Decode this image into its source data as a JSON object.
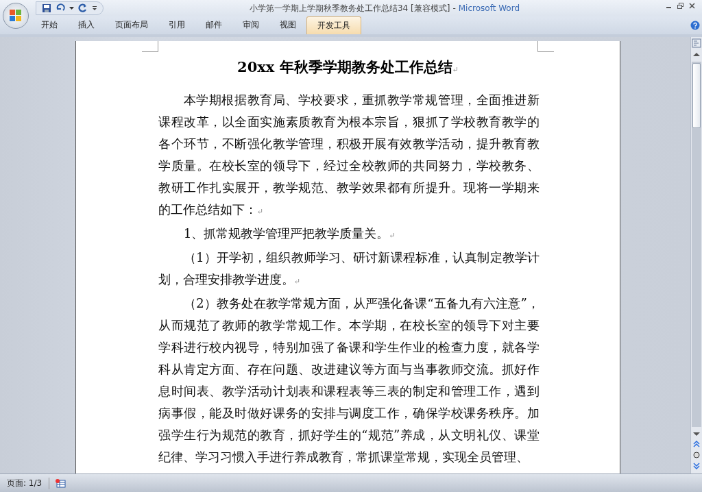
{
  "window": {
    "document_title": "小学第一学期上学期秋季教务处工作总结34 [兼容模式]",
    "separator": "-",
    "app_name": "Microsoft Word"
  },
  "tabs": [
    {
      "label": "开始",
      "selected": false
    },
    {
      "label": "插入",
      "selected": false
    },
    {
      "label": "页面布局",
      "selected": false
    },
    {
      "label": "引用",
      "selected": false
    },
    {
      "label": "邮件",
      "selected": false
    },
    {
      "label": "审阅",
      "selected": false
    },
    {
      "label": "视图",
      "selected": false
    },
    {
      "label": "开发工具",
      "selected": true
    }
  ],
  "document": {
    "title_prefix": "20xx",
    "title_rest": "年秋季学期教务处工作总结",
    "title_mark": "↵",
    "paragraphs": [
      {
        "mark": "↵",
        "text": "本学期根据教育局、学校要求，重抓教学常规管理，全面推进新课程改革，以全面实施素质教育为根本宗旨，狠抓了学校教育教学的各个环节，不断强化教学管理，积极开展有效教学活动，提升教育教学质量。在校长室的领导下，经过全校教师的共同努力，学校教务、教研工作扎实展开，教学规范、教学效果都有所提升。现将一学期来的工作总结如下："
      },
      {
        "mark": "↵",
        "text": "1、抓常规教学管理严把教学质量关。"
      },
      {
        "mark": "↵",
        "text": "（1）开学初，组织教师学习、研讨新课程标准，认真制定教学计划，合理安排教学进度。"
      },
      {
        "text": "（2）教务处在教学常规方面，从严强化备课“五备九有六注意”，从而规范了教师的教学常规工作。本学期，在校长室的领导下对主要学科进行校内视导，特别加强了备课和学生作业的检查力度，就各学科从肯定方面、存在问题、改进建议等方面与当事教师交流。抓好作息时间表、教学活动计划表和课程表等三表的制定和管理工作，遇到病事假，能及时做好课务的安排与调度工作，确保学校课务秩序。加强学生行为规范的教育，抓好学生的“规范”养成，从文明礼仪、课堂纪律、学习习惯入手进行养成教育，常抓课堂常规，实现全员管理、"
      }
    ]
  },
  "status_bar": {
    "page": "页面: 1/3"
  }
}
